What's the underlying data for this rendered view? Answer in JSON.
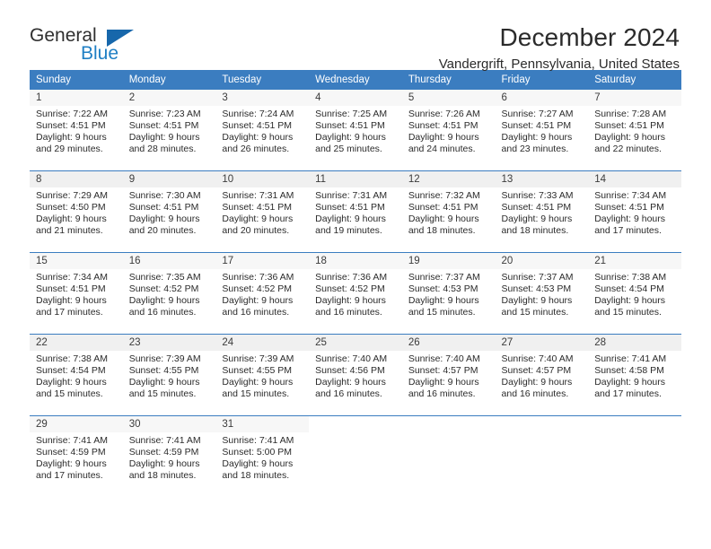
{
  "brand": {
    "word1": "General",
    "word2": "Blue",
    "accent_color": "#1767ab",
    "blue_text_color": "#1f7fc4",
    "logo_icon": "triangle-flag-icon"
  },
  "header": {
    "month_title": "December 2024",
    "location": "Vandergrift, Pennsylvania, United States"
  },
  "calendar": {
    "header_bg": "#3b7dc0",
    "weekday_headers": [
      "Sunday",
      "Monday",
      "Tuesday",
      "Wednesday",
      "Thursday",
      "Friday",
      "Saturday"
    ],
    "weeks": [
      [
        {
          "day": "1",
          "sunrise": "Sunrise: 7:22 AM",
          "sunset": "Sunset: 4:51 PM",
          "daylight_line1": "Daylight: 9 hours",
          "daylight_line2": "and 29 minutes."
        },
        {
          "day": "2",
          "sunrise": "Sunrise: 7:23 AM",
          "sunset": "Sunset: 4:51 PM",
          "daylight_line1": "Daylight: 9 hours",
          "daylight_line2": "and 28 minutes."
        },
        {
          "day": "3",
          "sunrise": "Sunrise: 7:24 AM",
          "sunset": "Sunset: 4:51 PM",
          "daylight_line1": "Daylight: 9 hours",
          "daylight_line2": "and 26 minutes."
        },
        {
          "day": "4",
          "sunrise": "Sunrise: 7:25 AM",
          "sunset": "Sunset: 4:51 PM",
          "daylight_line1": "Daylight: 9 hours",
          "daylight_line2": "and 25 minutes."
        },
        {
          "day": "5",
          "sunrise": "Sunrise: 7:26 AM",
          "sunset": "Sunset: 4:51 PM",
          "daylight_line1": "Daylight: 9 hours",
          "daylight_line2": "and 24 minutes."
        },
        {
          "day": "6",
          "sunrise": "Sunrise: 7:27 AM",
          "sunset": "Sunset: 4:51 PM",
          "daylight_line1": "Daylight: 9 hours",
          "daylight_line2": "and 23 minutes."
        },
        {
          "day": "7",
          "sunrise": "Sunrise: 7:28 AM",
          "sunset": "Sunset: 4:51 PM",
          "daylight_line1": "Daylight: 9 hours",
          "daylight_line2": "and 22 minutes."
        }
      ],
      [
        {
          "day": "8",
          "sunrise": "Sunrise: 7:29 AM",
          "sunset": "Sunset: 4:50 PM",
          "daylight_line1": "Daylight: 9 hours",
          "daylight_line2": "and 21 minutes."
        },
        {
          "day": "9",
          "sunrise": "Sunrise: 7:30 AM",
          "sunset": "Sunset: 4:51 PM",
          "daylight_line1": "Daylight: 9 hours",
          "daylight_line2": "and 20 minutes."
        },
        {
          "day": "10",
          "sunrise": "Sunrise: 7:31 AM",
          "sunset": "Sunset: 4:51 PM",
          "daylight_line1": "Daylight: 9 hours",
          "daylight_line2": "and 20 minutes."
        },
        {
          "day": "11",
          "sunrise": "Sunrise: 7:31 AM",
          "sunset": "Sunset: 4:51 PM",
          "daylight_line1": "Daylight: 9 hours",
          "daylight_line2": "and 19 minutes."
        },
        {
          "day": "12",
          "sunrise": "Sunrise: 7:32 AM",
          "sunset": "Sunset: 4:51 PM",
          "daylight_line1": "Daylight: 9 hours",
          "daylight_line2": "and 18 minutes."
        },
        {
          "day": "13",
          "sunrise": "Sunrise: 7:33 AM",
          "sunset": "Sunset: 4:51 PM",
          "daylight_line1": "Daylight: 9 hours",
          "daylight_line2": "and 18 minutes."
        },
        {
          "day": "14",
          "sunrise": "Sunrise: 7:34 AM",
          "sunset": "Sunset: 4:51 PM",
          "daylight_line1": "Daylight: 9 hours",
          "daylight_line2": "and 17 minutes."
        }
      ],
      [
        {
          "day": "15",
          "sunrise": "Sunrise: 7:34 AM",
          "sunset": "Sunset: 4:51 PM",
          "daylight_line1": "Daylight: 9 hours",
          "daylight_line2": "and 17 minutes."
        },
        {
          "day": "16",
          "sunrise": "Sunrise: 7:35 AM",
          "sunset": "Sunset: 4:52 PM",
          "daylight_line1": "Daylight: 9 hours",
          "daylight_line2": "and 16 minutes."
        },
        {
          "day": "17",
          "sunrise": "Sunrise: 7:36 AM",
          "sunset": "Sunset: 4:52 PM",
          "daylight_line1": "Daylight: 9 hours",
          "daylight_line2": "and 16 minutes."
        },
        {
          "day": "18",
          "sunrise": "Sunrise: 7:36 AM",
          "sunset": "Sunset: 4:52 PM",
          "daylight_line1": "Daylight: 9 hours",
          "daylight_line2": "and 16 minutes."
        },
        {
          "day": "19",
          "sunrise": "Sunrise: 7:37 AM",
          "sunset": "Sunset: 4:53 PM",
          "daylight_line1": "Daylight: 9 hours",
          "daylight_line2": "and 15 minutes."
        },
        {
          "day": "20",
          "sunrise": "Sunrise: 7:37 AM",
          "sunset": "Sunset: 4:53 PM",
          "daylight_line1": "Daylight: 9 hours",
          "daylight_line2": "and 15 minutes."
        },
        {
          "day": "21",
          "sunrise": "Sunrise: 7:38 AM",
          "sunset": "Sunset: 4:54 PM",
          "daylight_line1": "Daylight: 9 hours",
          "daylight_line2": "and 15 minutes."
        }
      ],
      [
        {
          "day": "22",
          "sunrise": "Sunrise: 7:38 AM",
          "sunset": "Sunset: 4:54 PM",
          "daylight_line1": "Daylight: 9 hours",
          "daylight_line2": "and 15 minutes."
        },
        {
          "day": "23",
          "sunrise": "Sunrise: 7:39 AM",
          "sunset": "Sunset: 4:55 PM",
          "daylight_line1": "Daylight: 9 hours",
          "daylight_line2": "and 15 minutes."
        },
        {
          "day": "24",
          "sunrise": "Sunrise: 7:39 AM",
          "sunset": "Sunset: 4:55 PM",
          "daylight_line1": "Daylight: 9 hours",
          "daylight_line2": "and 15 minutes."
        },
        {
          "day": "25",
          "sunrise": "Sunrise: 7:40 AM",
          "sunset": "Sunset: 4:56 PM",
          "daylight_line1": "Daylight: 9 hours",
          "daylight_line2": "and 16 minutes."
        },
        {
          "day": "26",
          "sunrise": "Sunrise: 7:40 AM",
          "sunset": "Sunset: 4:57 PM",
          "daylight_line1": "Daylight: 9 hours",
          "daylight_line2": "and 16 minutes."
        },
        {
          "day": "27",
          "sunrise": "Sunrise: 7:40 AM",
          "sunset": "Sunset: 4:57 PM",
          "daylight_line1": "Daylight: 9 hours",
          "daylight_line2": "and 16 minutes."
        },
        {
          "day": "28",
          "sunrise": "Sunrise: 7:41 AM",
          "sunset": "Sunset: 4:58 PM",
          "daylight_line1": "Daylight: 9 hours",
          "daylight_line2": "and 17 minutes."
        }
      ],
      [
        {
          "day": "29",
          "sunrise": "Sunrise: 7:41 AM",
          "sunset": "Sunset: 4:59 PM",
          "daylight_line1": "Daylight: 9 hours",
          "daylight_line2": "and 17 minutes."
        },
        {
          "day": "30",
          "sunrise": "Sunrise: 7:41 AM",
          "sunset": "Sunset: 4:59 PM",
          "daylight_line1": "Daylight: 9 hours",
          "daylight_line2": "and 18 minutes."
        },
        {
          "day": "31",
          "sunrise": "Sunrise: 7:41 AM",
          "sunset": "Sunset: 5:00 PM",
          "daylight_line1": "Daylight: 9 hours",
          "daylight_line2": "and 18 minutes."
        },
        {
          "day": "",
          "sunrise": "",
          "sunset": "",
          "daylight_line1": "",
          "daylight_line2": ""
        },
        {
          "day": "",
          "sunrise": "",
          "sunset": "",
          "daylight_line1": "",
          "daylight_line2": ""
        },
        {
          "day": "",
          "sunrise": "",
          "sunset": "",
          "daylight_line1": "",
          "daylight_line2": ""
        },
        {
          "day": "",
          "sunrise": "",
          "sunset": "",
          "daylight_line1": "",
          "daylight_line2": ""
        }
      ]
    ]
  }
}
